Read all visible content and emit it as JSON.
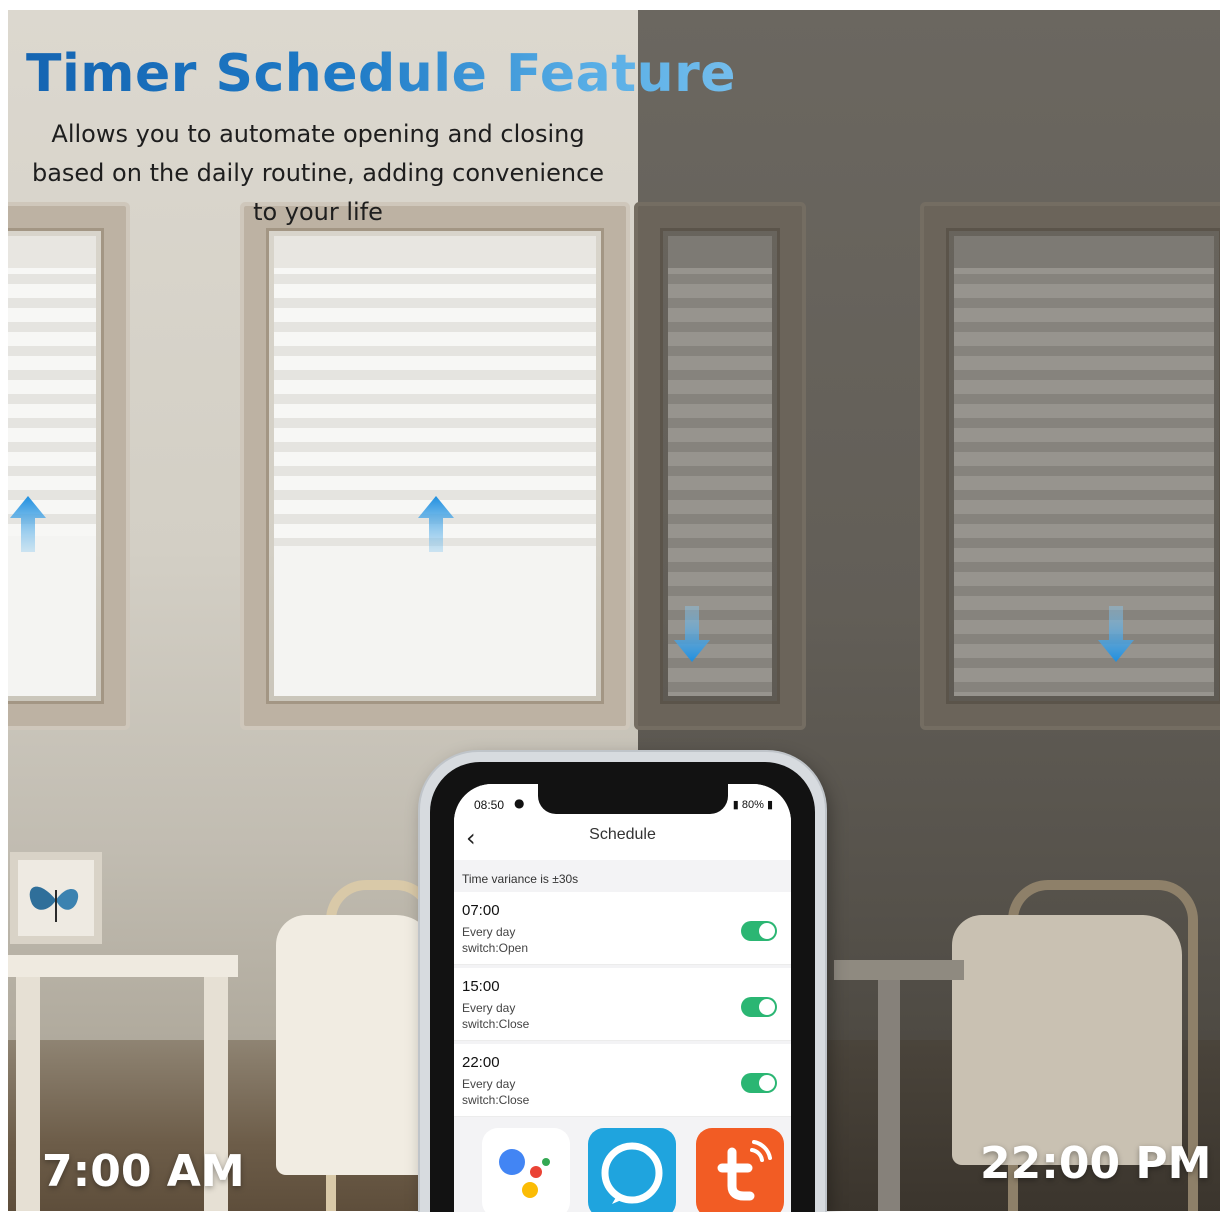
{
  "banner": {
    "headline": "Timer Schedule Feature",
    "subtext_lines": [
      "Allows you to automate opening and closing",
      "based on the daily routine, adding convenience",
      "to your life"
    ],
    "morning_label": "7:00 AM",
    "night_label": "22:00 PM"
  },
  "phone": {
    "status_bar": {
      "time": "08:50",
      "battery": "80%"
    },
    "nav": {
      "title": "Schedule"
    },
    "variance_text": "Time variance is ±30s",
    "schedules": [
      {
        "time": "07:00",
        "repeat": "Every day",
        "action": "switch:Open",
        "enabled": true
      },
      {
        "time": "15:00",
        "repeat": "Every day",
        "action": "switch:Close",
        "enabled": true
      },
      {
        "time": "22:00",
        "repeat": "Every day",
        "action": "switch:Close",
        "enabled": true
      }
    ],
    "app_icons": [
      "google-assistant-icon",
      "alexa-icon",
      "tuya-icon"
    ]
  },
  "colors": {
    "headline_start": "#1565b2",
    "headline_end": "#74bdec",
    "arrow_blue": "#1e8fe0",
    "toggle_green": "#2bb673",
    "alexa_blue": "#1fa4de",
    "tuya_orange": "#f25c24"
  }
}
